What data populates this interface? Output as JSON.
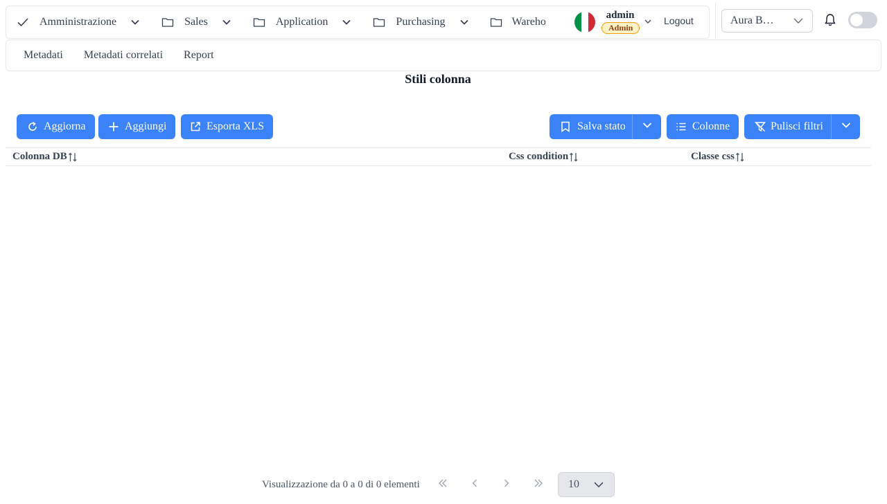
{
  "menubar": {
    "items": [
      {
        "label": "Amministrazione",
        "icon": "check-icon"
      },
      {
        "label": "Sales",
        "icon": "folder-icon"
      },
      {
        "label": "Application",
        "icon": "folder-icon"
      },
      {
        "label": "Purchasing",
        "icon": "folder-icon"
      },
      {
        "label": "Warehou",
        "icon": "folder-icon"
      }
    ]
  },
  "user": {
    "name": "admin",
    "role": "Admin",
    "logout_label": "Logout"
  },
  "company": {
    "selected": "Aura B…"
  },
  "subnav": {
    "items": [
      "Metadati",
      "Metadati correlati",
      "Report"
    ]
  },
  "page": {
    "title": "Stili colonna"
  },
  "toolbar": {
    "refresh_label": "Aggiorna",
    "add_label": "Aggiungi",
    "export_label": "Esporta XLS",
    "save_state_label": "Salva stato",
    "columns_label": "Colonne",
    "clear_filters_label": "Pulisci filtri"
  },
  "table": {
    "columns": [
      "Colonna DB",
      "Css condition",
      "Classe css"
    ]
  },
  "paginator": {
    "report": "Visualizzazione da 0 a 0 di 0 elementi",
    "rows_per_page": "10"
  },
  "colors": {
    "primary": "#3b82f6",
    "flag_green": "#009246",
    "flag_white": "#ffffff",
    "flag_red": "#ce2b37"
  }
}
